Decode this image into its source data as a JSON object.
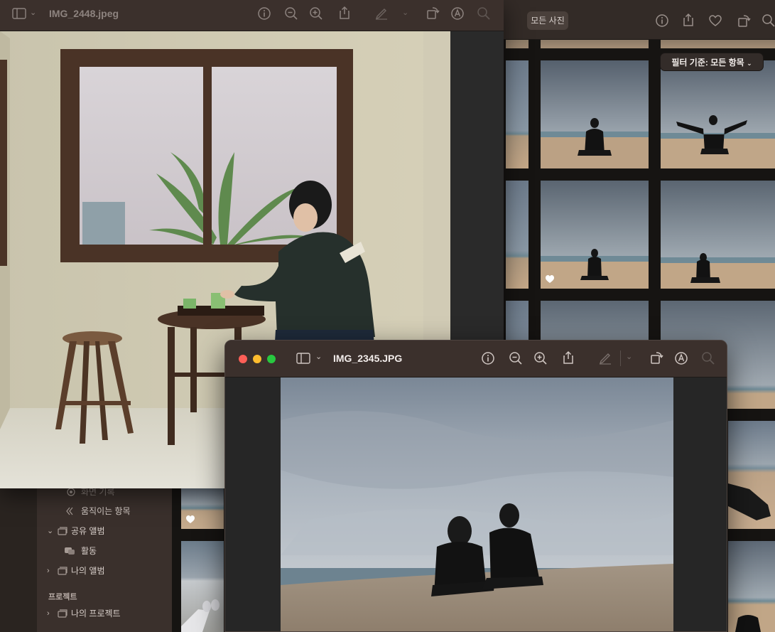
{
  "photos_app": {
    "toolbar": {
      "segment_label": "모든 사진",
      "icons": [
        "info-icon",
        "share-icon",
        "heart-icon",
        "rotate-icon",
        "search-icon"
      ]
    },
    "filter": {
      "label": "필터 기준: 모든 항목"
    },
    "sidebar": {
      "items": [
        {
          "label": "화면 기록"
        },
        {
          "label": "움직이는 항목"
        },
        {
          "label": "공유 앨범"
        },
        {
          "label": "활동"
        },
        {
          "label": "나의 앨범"
        }
      ],
      "section_projects": "프로젝트",
      "project_item": "나의 프로젝트"
    }
  },
  "preview_window_1": {
    "title": "IMG_2448.jpeg",
    "toolbar_icons": [
      "sidebar-toggle-icon",
      "info-icon",
      "zoom-out-icon",
      "zoom-in-icon",
      "share-icon",
      "markup-pen-icon",
      "rotate-icon",
      "markup-icon",
      "search-icon"
    ]
  },
  "preview_window_2": {
    "title": "IMG_2345.JPG",
    "toolbar_icons": [
      "sidebar-toggle-icon",
      "info-icon",
      "zoom-out-icon",
      "zoom-in-icon",
      "share-icon",
      "markup-pen-icon",
      "rotate-icon",
      "markup-icon",
      "search-icon"
    ],
    "traffic_lights": {
      "close": "#ff5f57",
      "minimize": "#febc2e",
      "zoom": "#28c840"
    }
  },
  "colors": {
    "titlebar": "#3b302c",
    "sidebar": "#3a302c",
    "grid_bg": "#161412"
  }
}
